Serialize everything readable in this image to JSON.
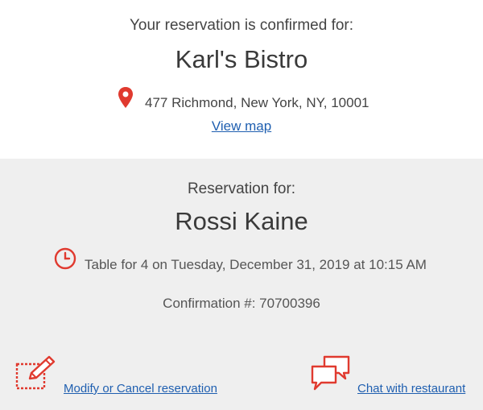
{
  "header": {
    "confirmed_label": "Your reservation is confirmed for:",
    "restaurant_name": "Karl's Bistro",
    "address": "477 Richmond, New York, NY, 10001",
    "view_map_label": "View map"
  },
  "reservation": {
    "label": "Reservation for:",
    "guest_name": "Rossi Kaine",
    "details": "Table for 4 on Tuesday, December 31, 2019 at 10:15 AM",
    "confirmation": "Confirmation #: 70700396"
  },
  "actions": {
    "modify_label": "Modify or Cancel reservation",
    "chat_label": "Chat with restaurant"
  },
  "colors": {
    "accent_red": "#e03a2f",
    "link_blue": "#1f5fb0",
    "panel_gray": "#efefef"
  },
  "icons": {
    "location": "map-pin-icon",
    "time": "clock-icon",
    "modify": "edit-icon",
    "chat": "chat-bubbles-icon"
  }
}
